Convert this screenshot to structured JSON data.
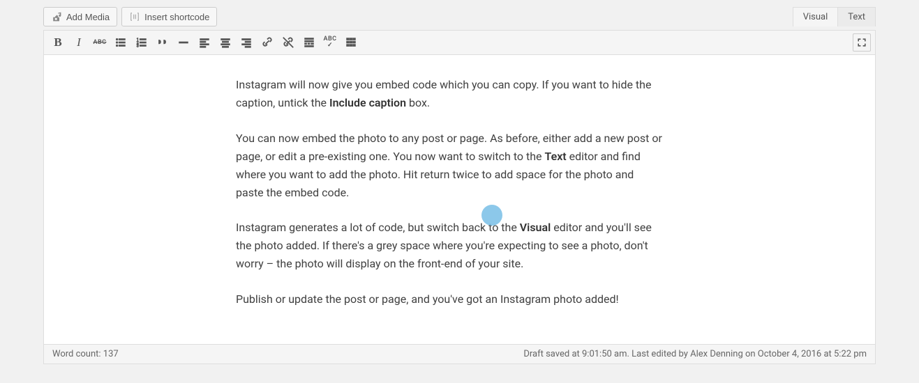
{
  "topButtons": {
    "addMedia": "Add Media",
    "insertShortcode": "Insert shortcode"
  },
  "tabs": {
    "visual": "Visual",
    "text": "Text"
  },
  "content": {
    "p1_a": "Instagram will now give you embed code which you can copy. If you want to hide the caption, untick the ",
    "p1_b": "Include caption",
    "p1_c": " box.",
    "p2_a": "You can now embed the photo to any post or page. As before, either add a new post or page, or edit a pre-existing one. You now want to switch to the ",
    "p2_b": "Text",
    "p2_c": " editor and find where you want to add the photo. Hit return twice to add space for the photo and paste the embed code.",
    "p3_a": "Instagram generates a lot of code, but switch back to the ",
    "p3_b": "Visual",
    "p3_c": " editor and you'll see the photo added. If there's a grey space where you're expecting to see a photo, don't worry – the photo will display on the front-end of your site.",
    "p4": "Publish or update the post or page, and you've got an Instagram photo added!"
  },
  "status": {
    "wordCountLabel": "Word count: ",
    "wordCount": "137",
    "draftInfo": "Draft saved at 9:01:50 am. Last edited by Alex Denning on October 4, 2016 at 5:22 pm"
  }
}
